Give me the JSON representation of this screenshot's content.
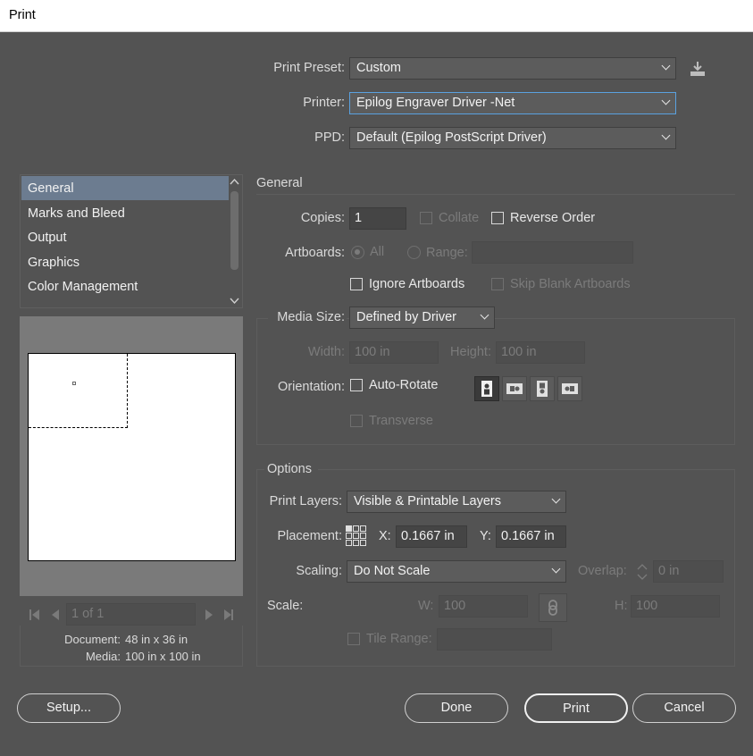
{
  "window": {
    "title": "Print"
  },
  "header": {
    "preset_label": "Print Preset:",
    "preset_value": "Custom",
    "printer_label": "Printer:",
    "printer_value": "Epilog Engraver Driver -Net",
    "ppd_label": "PPD:",
    "ppd_value": "Default (Epilog PostScript Driver)"
  },
  "sidebar": {
    "items": [
      {
        "label": "General"
      },
      {
        "label": "Marks and Bleed"
      },
      {
        "label": "Output"
      },
      {
        "label": "Graphics"
      },
      {
        "label": "Color Management"
      }
    ]
  },
  "preview": {
    "page_indicator": "1 of 1",
    "document_label": "Document:",
    "document_value": "48 in x 36 in",
    "media_label": "Media:",
    "media_value": "100 in x 100 in"
  },
  "general": {
    "title": "General",
    "copies_label": "Copies:",
    "copies_value": "1",
    "collate_label": "Collate",
    "reverse_label": "Reverse Order",
    "artboards_label": "Artboards:",
    "all_label": "All",
    "range_label": "Range:",
    "ignore_label": "Ignore Artboards",
    "skip_label": "Skip Blank Artboards",
    "media_size_label": "Media Size:",
    "media_size_value": "Defined by Driver",
    "width_label": "Width:",
    "width_value": "100 in",
    "height_label": "Height:",
    "height_value": "100 in",
    "orientation_label": "Orientation:",
    "autorotate_label": "Auto-Rotate",
    "transverse_label": "Transverse"
  },
  "options": {
    "title": "Options",
    "layers_label": "Print Layers:",
    "layers_value": "Visible & Printable Layers",
    "placement_label": "Placement:",
    "x_label": "X:",
    "x_value": "0.1667 in",
    "y_label": "Y:",
    "y_value": "0.1667 in",
    "scaling_label": "Scaling:",
    "scaling_value": "Do Not Scale",
    "overlap_label": "Overlap:",
    "overlap_value": "0 in",
    "scale_label": "Scale:",
    "w_label": "W:",
    "w_value": "100",
    "h_label": "H:",
    "h_value": "100",
    "tile_label": "Tile Range:"
  },
  "buttons": {
    "setup": "Setup...",
    "done": "Done",
    "print": "Print",
    "cancel": "Cancel"
  }
}
